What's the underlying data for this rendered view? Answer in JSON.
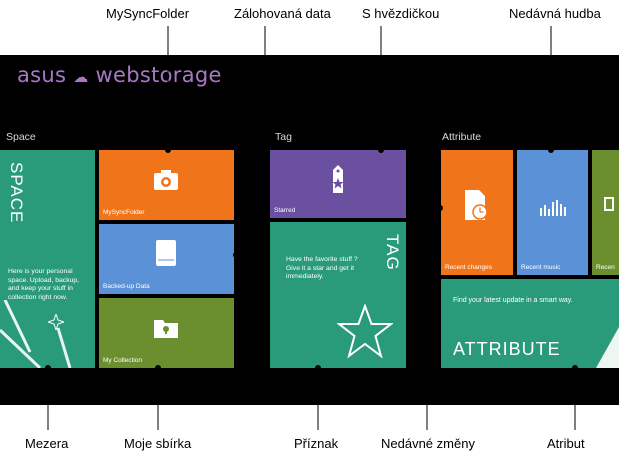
{
  "callouts": {
    "mysyncfolder": "MySyncFolder",
    "backed_up": "Zálohovaná data",
    "starred": "S hvězdičkou",
    "recent_music": "Nedávná hudba",
    "space": "Mezera",
    "my_collection": "Moje sbírka",
    "tag": "Příznak",
    "recent_changes": "Nedávné změny",
    "attribute": "Atribut"
  },
  "app": {
    "logo_asus": "asus",
    "logo_webstorage": "webstorage"
  },
  "groups": {
    "space": "Space",
    "tag": "Tag",
    "attribute": "Attribute"
  },
  "tiles": {
    "space_title": "SPACE",
    "space_desc": "Here is your personal space. Upload, backup, and keep your stuff in collection right now.",
    "mysyncfolder": "MySyncFolder",
    "backed_up": "Backed-up Data",
    "my_collection": "My Collection",
    "starred": "Starred",
    "tag_title": "TAG",
    "tag_desc": "Have the favorite stuff ? Give it a star and get it immediately.",
    "recent_changes": "Recent changes",
    "recent_music": "Recent music",
    "recent_partial": "Recen",
    "attribute_desc": "Find your latest update in a smart way.",
    "attribute_title": "ATTRIBUTE"
  },
  "colors": {
    "teal": "#2a9b7a",
    "orange": "#f0751a",
    "blue": "#5b91d6",
    "olive": "#6b8f2e",
    "purple": "#6b4fa0",
    "logo": "#a878c8"
  },
  "icons": [
    "camera-sync-icon",
    "drive-icon",
    "lock-folder-icon",
    "star-tag-icon",
    "star-outline-icon",
    "clock-document-icon",
    "equalizer-icon"
  ]
}
